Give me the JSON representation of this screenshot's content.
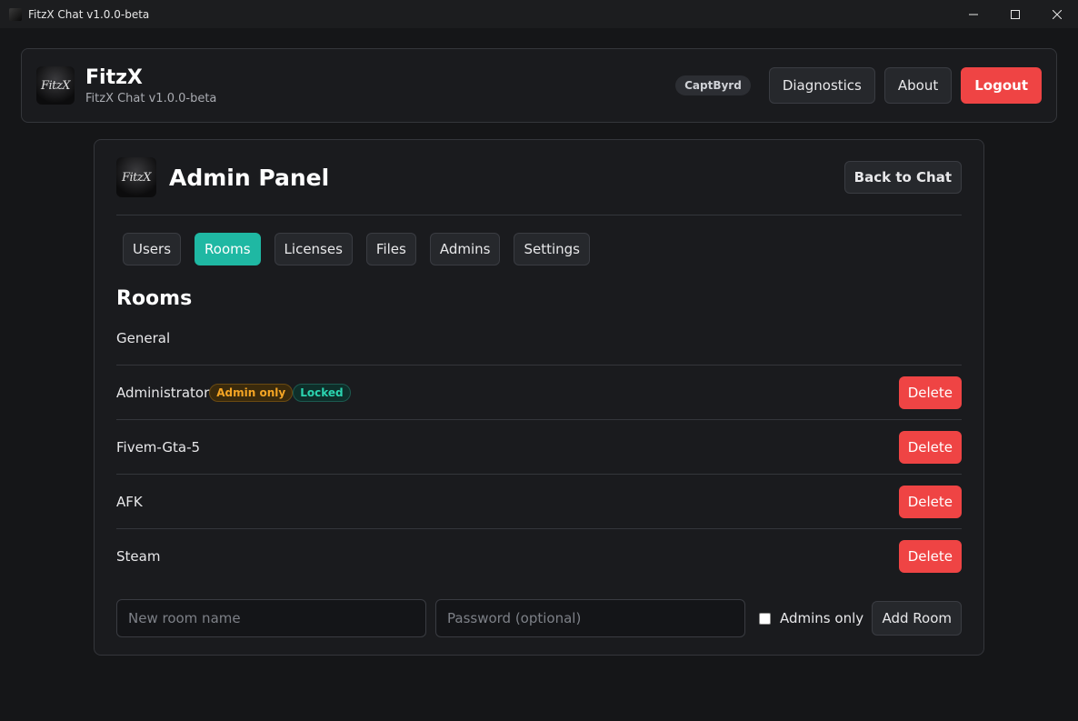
{
  "window": {
    "title": "FitzX Chat v1.0.0-beta",
    "controls": [
      "minimize-icon",
      "maximize-icon",
      "close-icon"
    ]
  },
  "header": {
    "logo_text": "FitzX",
    "brand_name": "FitzX",
    "subtitle": "FitzX Chat v1.0.0-beta",
    "username": "CaptByrd",
    "buttons": {
      "diagnostics": "Diagnostics",
      "about": "About",
      "logout": "Logout"
    }
  },
  "panel": {
    "logo_text": "FitzX",
    "title": "Admin Panel",
    "back_label": "Back to Chat",
    "tabs": [
      {
        "label": "Users",
        "active": false
      },
      {
        "label": "Rooms",
        "active": true
      },
      {
        "label": "Licenses",
        "active": false
      },
      {
        "label": "Files",
        "active": false
      },
      {
        "label": "Admins",
        "active": false
      },
      {
        "label": "Settings",
        "active": false
      }
    ],
    "section_title": "Rooms",
    "rooms": [
      {
        "name": "General"
      },
      {
        "name": "Administrator",
        "badges": [
          "Admin only",
          "Locked"
        ],
        "action": "Delete"
      },
      {
        "name": "Fivem-Gta-5",
        "action": "Delete"
      },
      {
        "name": "AFK",
        "action": "Delete"
      },
      {
        "name": "Steam",
        "action": "Delete"
      }
    ],
    "add_form": {
      "room_name_placeholder": "New room name",
      "password_placeholder": "Password (optional)",
      "admins_only_label": "Admins only",
      "admins_only_checked": false,
      "add_label": "Add Room"
    }
  },
  "colors": {
    "accent": "#1fb8a3",
    "danger": "#ef4444",
    "background": "#151618",
    "card": "#1a1b1e"
  }
}
